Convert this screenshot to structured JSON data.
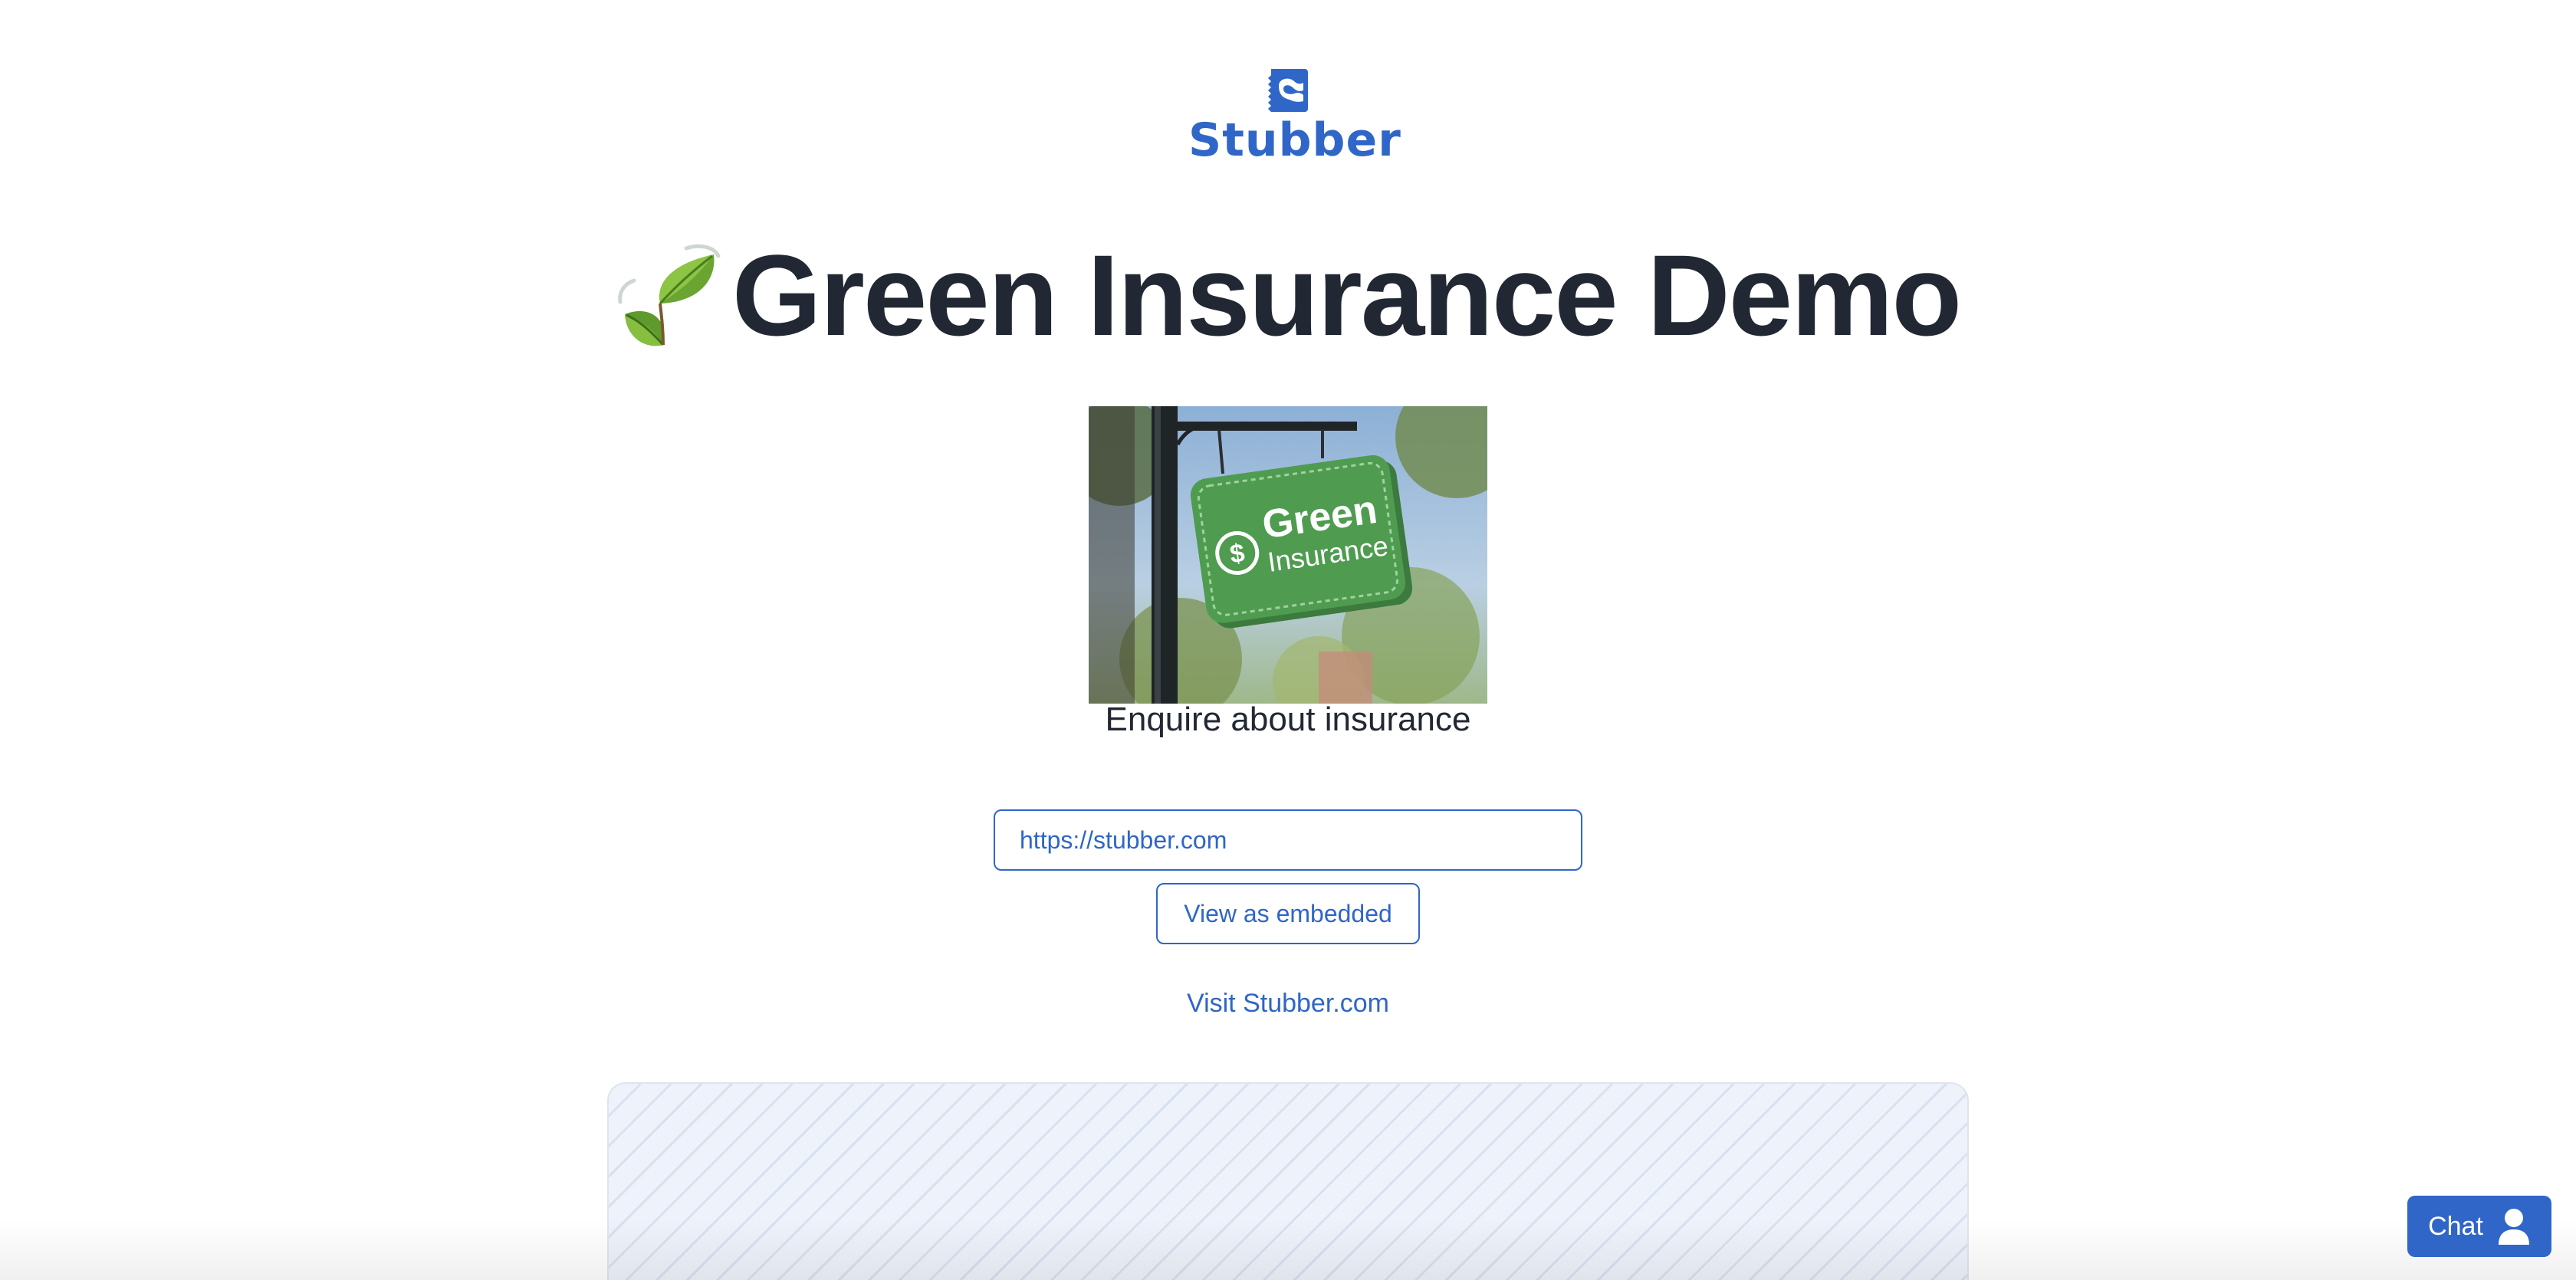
{
  "brand": {
    "name": "Stubber",
    "logo_icon": "stubber-ticket-icon",
    "color": "#2f66c8"
  },
  "header": {
    "title": "Green Insurance Demo",
    "title_icon": "leaf-icon",
    "title_color": "#222833"
  },
  "hero": {
    "image": "green-insurance-sign-photo",
    "image_text": {
      "line1": "Green",
      "line2": "Insurance"
    },
    "sign_color": "#4f9c50"
  },
  "main": {
    "subtitle": "Enquire about insurance",
    "url_input_value": "https://stubber.com",
    "embed_button_label": "View as embedded",
    "visit_link_label": "Visit Stubber.com"
  },
  "chat": {
    "label": "Chat",
    "icon": "person-icon"
  }
}
